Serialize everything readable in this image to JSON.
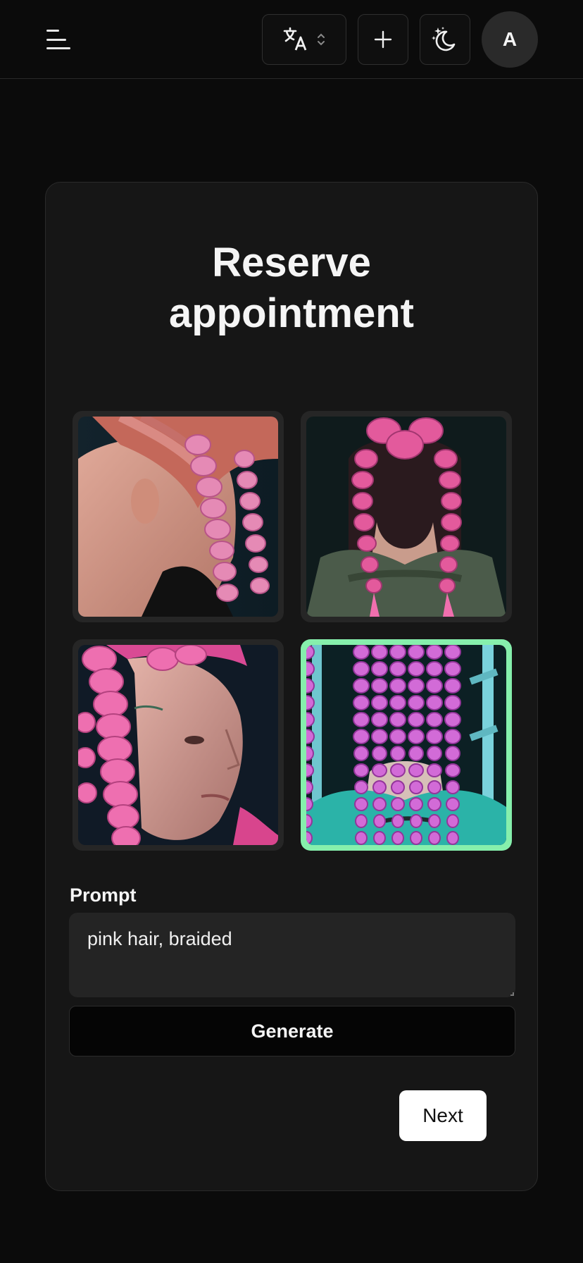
{
  "header": {
    "menu_icon": "hamburger-icon",
    "language_icon": "translate-icon",
    "language_chevron_icon": "chevron-up-down-icon",
    "add_icon": "plus-icon",
    "theme_icon": "moon-stars-icon",
    "avatar_initial": "A"
  },
  "main": {
    "title": "Reserve\nappointment",
    "gallery": [
      {
        "name": "pink braids side profile",
        "selected": false
      },
      {
        "name": "pink braids back view",
        "selected": false
      },
      {
        "name": "pink braids face profile",
        "selected": false
      },
      {
        "name": "pink cornrows back view",
        "selected": true
      }
    ],
    "prompt_label": "Prompt",
    "prompt_value": "pink hair, braided",
    "generate_label": "Generate",
    "next_label": "Next"
  },
  "colors": {
    "background": "#0b0b0b",
    "card": "#161616",
    "selected_border": "#86efac",
    "button_light": "#ffffff"
  }
}
